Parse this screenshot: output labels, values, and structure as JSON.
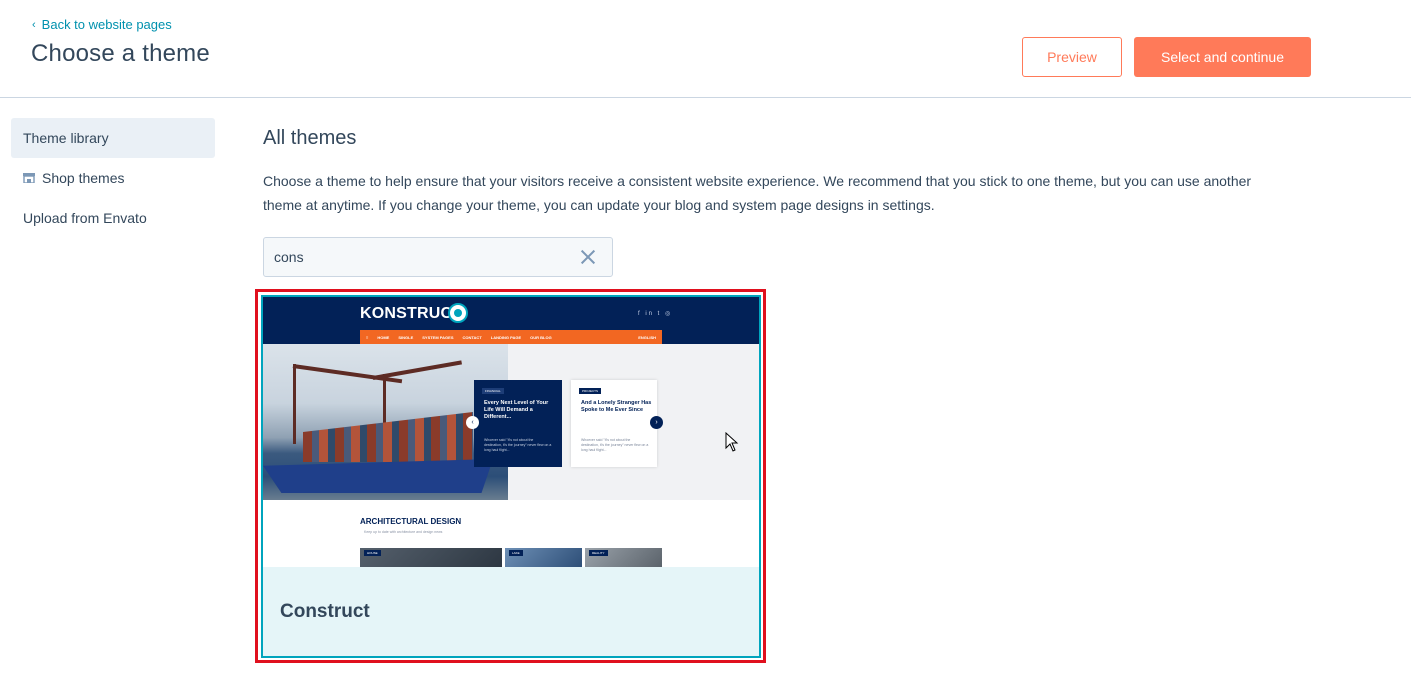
{
  "header": {
    "back_link": "Back to website pages",
    "title": "Choose a theme",
    "preview_label": "Preview",
    "select_label": "Select and continue"
  },
  "sidebar": {
    "items": [
      {
        "label": "Theme library",
        "active": true
      },
      {
        "label": "Shop themes",
        "icon": "store-icon"
      },
      {
        "label": "Upload from Envato"
      }
    ]
  },
  "main": {
    "title": "All themes",
    "description": "Choose a theme to help ensure that your visitors receive a consistent website experience. We recommend that you stick to one theme, but you can use another theme at anytime. If you change your theme, you can update your blog and system page designs in settings.",
    "search": {
      "value": "cons"
    }
  },
  "theme_card": {
    "name": "Construct",
    "selected": true,
    "preview": {
      "brand": "KONSTRUCT",
      "nav": [
        "HOME",
        "SINGLE",
        "SYSTEM PAGES",
        "CONTACT",
        "LANDING PAGE",
        "OUR BLOG"
      ],
      "nav_right": "ENGLISH",
      "card1_tag": "FINANCIAL",
      "card1_title": "Every Next Level of Your Life Will Demand a Different...",
      "card1_text": "Whoever said \"It's not about the destination, it's the journey\" never flew on a long haul flight...",
      "card2_tag": "PROJECTS",
      "card2_title": "And a Lonely Stranger Has Spoke to Me Ever Since",
      "card2_text": "Whoever said \"It's not about the destination, it's the journey\" never flew on a long haul flight...",
      "section_title": "ARCHITECTURAL DESIGN",
      "section_sub": "Keep up to date with architecture and design news",
      "tiles": [
        "HOUSE",
        "LAKE",
        "REALITY"
      ]
    }
  },
  "colors": {
    "accent": "#ff7a59",
    "link": "#0091ae",
    "selected_border": "#00a4bd",
    "highlight": "#e0101e"
  }
}
